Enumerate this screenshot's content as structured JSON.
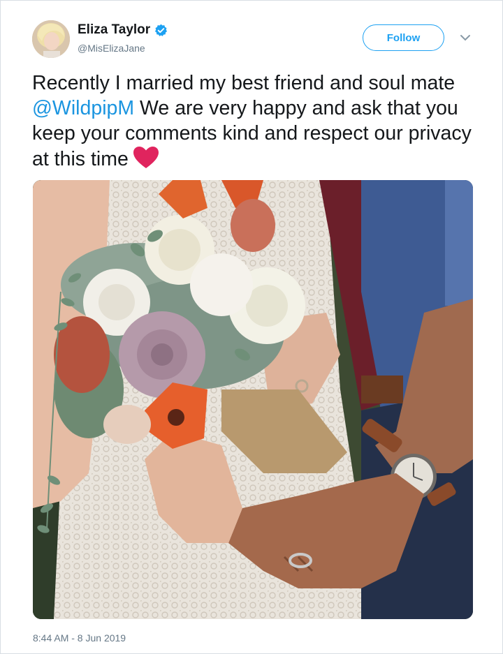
{
  "author": {
    "name": "Eliza Taylor",
    "handle": "@MisElizaJane",
    "verified_icon": "verified-badge-icon",
    "avatar_icon": "profile-avatar"
  },
  "follow_button": {
    "label": "Follow"
  },
  "menu": {
    "icon": "chevron-down-icon"
  },
  "tweet": {
    "text_part1": "Recently I married my best friend and soul mate ",
    "mention": "@WildpipM",
    "text_part2": " We are very happy and ask that you keep your comments kind and respect our privacy at this time",
    "emoji_icon": "red-heart-icon"
  },
  "media": {
    "icon": "wedding-photo-image"
  },
  "timestamp": "8:44 AM - 8 Jun 2019",
  "colors": {
    "accent": "#1da1f2",
    "mention": "#1b95e0",
    "text": "#14171a",
    "secondary_text": "#657786",
    "heart": "#e0245e"
  }
}
